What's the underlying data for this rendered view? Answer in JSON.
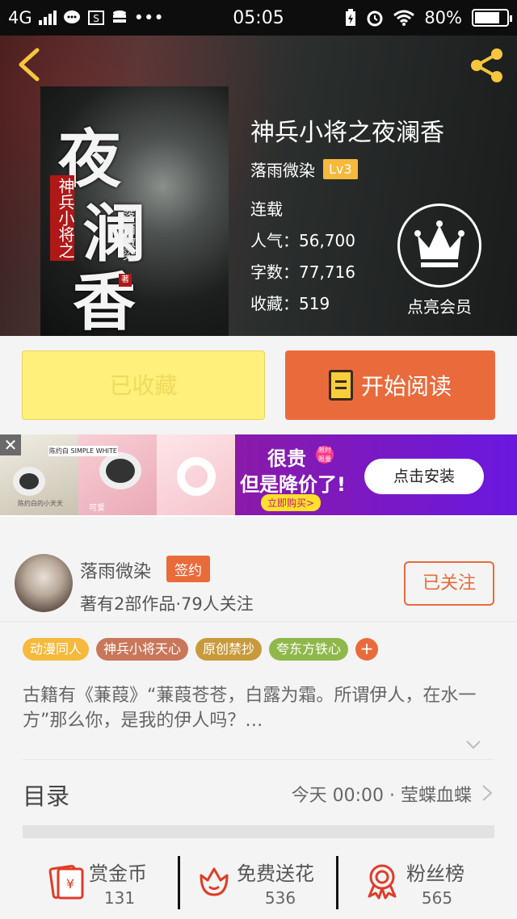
{
  "statusbar": {
    "network": "4G",
    "time": "05:05",
    "battery": "80%"
  },
  "book": {
    "cover_title": "夜澜香",
    "cover_title_chars": [
      "夜",
      "澜",
      "香"
    ],
    "cover_subtitle": "神兵小将之",
    "cover_author": "落雨微染",
    "cover_seal": "著",
    "title": "神兵小将之夜澜香",
    "author": "落雨微染",
    "level": "Lv3",
    "status": "连载",
    "popularity": "人气：56,700",
    "word_count": "字数：77,716",
    "favorites": "收藏：519",
    "vip_label": "点亮会员"
  },
  "actions": {
    "favorited_label": "已收藏",
    "read_label": "开始阅读"
  },
  "ad": {
    "headline": "很贵",
    "badge": "限时限量",
    "subline": "但是降价了!",
    "cta_small": "立即购买>",
    "install_label": "点击安装",
    "close": "✕",
    "label1": "陈约白 SIMPLE WHITE",
    "label2": "陈约白的小天天",
    "label3": "可爱"
  },
  "author_section": {
    "name": "落雨微染",
    "badge": "签约",
    "stats": "著有2部作品·79人关注",
    "follow_label": "已关注"
  },
  "tags": [
    {
      "label": "动漫同人",
      "color": "#f6b93c"
    },
    {
      "label": "神兵小将天心",
      "color": "#c9765a"
    },
    {
      "label": "原创禁抄",
      "color": "#c99a3c"
    },
    {
      "label": "夸东方铁心",
      "color": "#8fb84a"
    }
  ],
  "tag_more": "+",
  "description": "古籍有《蒹葭》“蒹葭苍苍，白露为霜。所谓伊人，在水一方”那么你，是我的伊人吗？…",
  "toc": {
    "label": "目录",
    "latest": "今天 00:00 · 莹蝶血蝶"
  },
  "bottom": [
    {
      "label": "赏金币",
      "value": "131"
    },
    {
      "label": "免费送花",
      "value": "536"
    },
    {
      "label": "粉丝榜",
      "value": "565"
    }
  ],
  "colors": {
    "accent": "#e96b3c",
    "favorite_button": "#fef07a",
    "level_badge": "#f6b93c"
  }
}
